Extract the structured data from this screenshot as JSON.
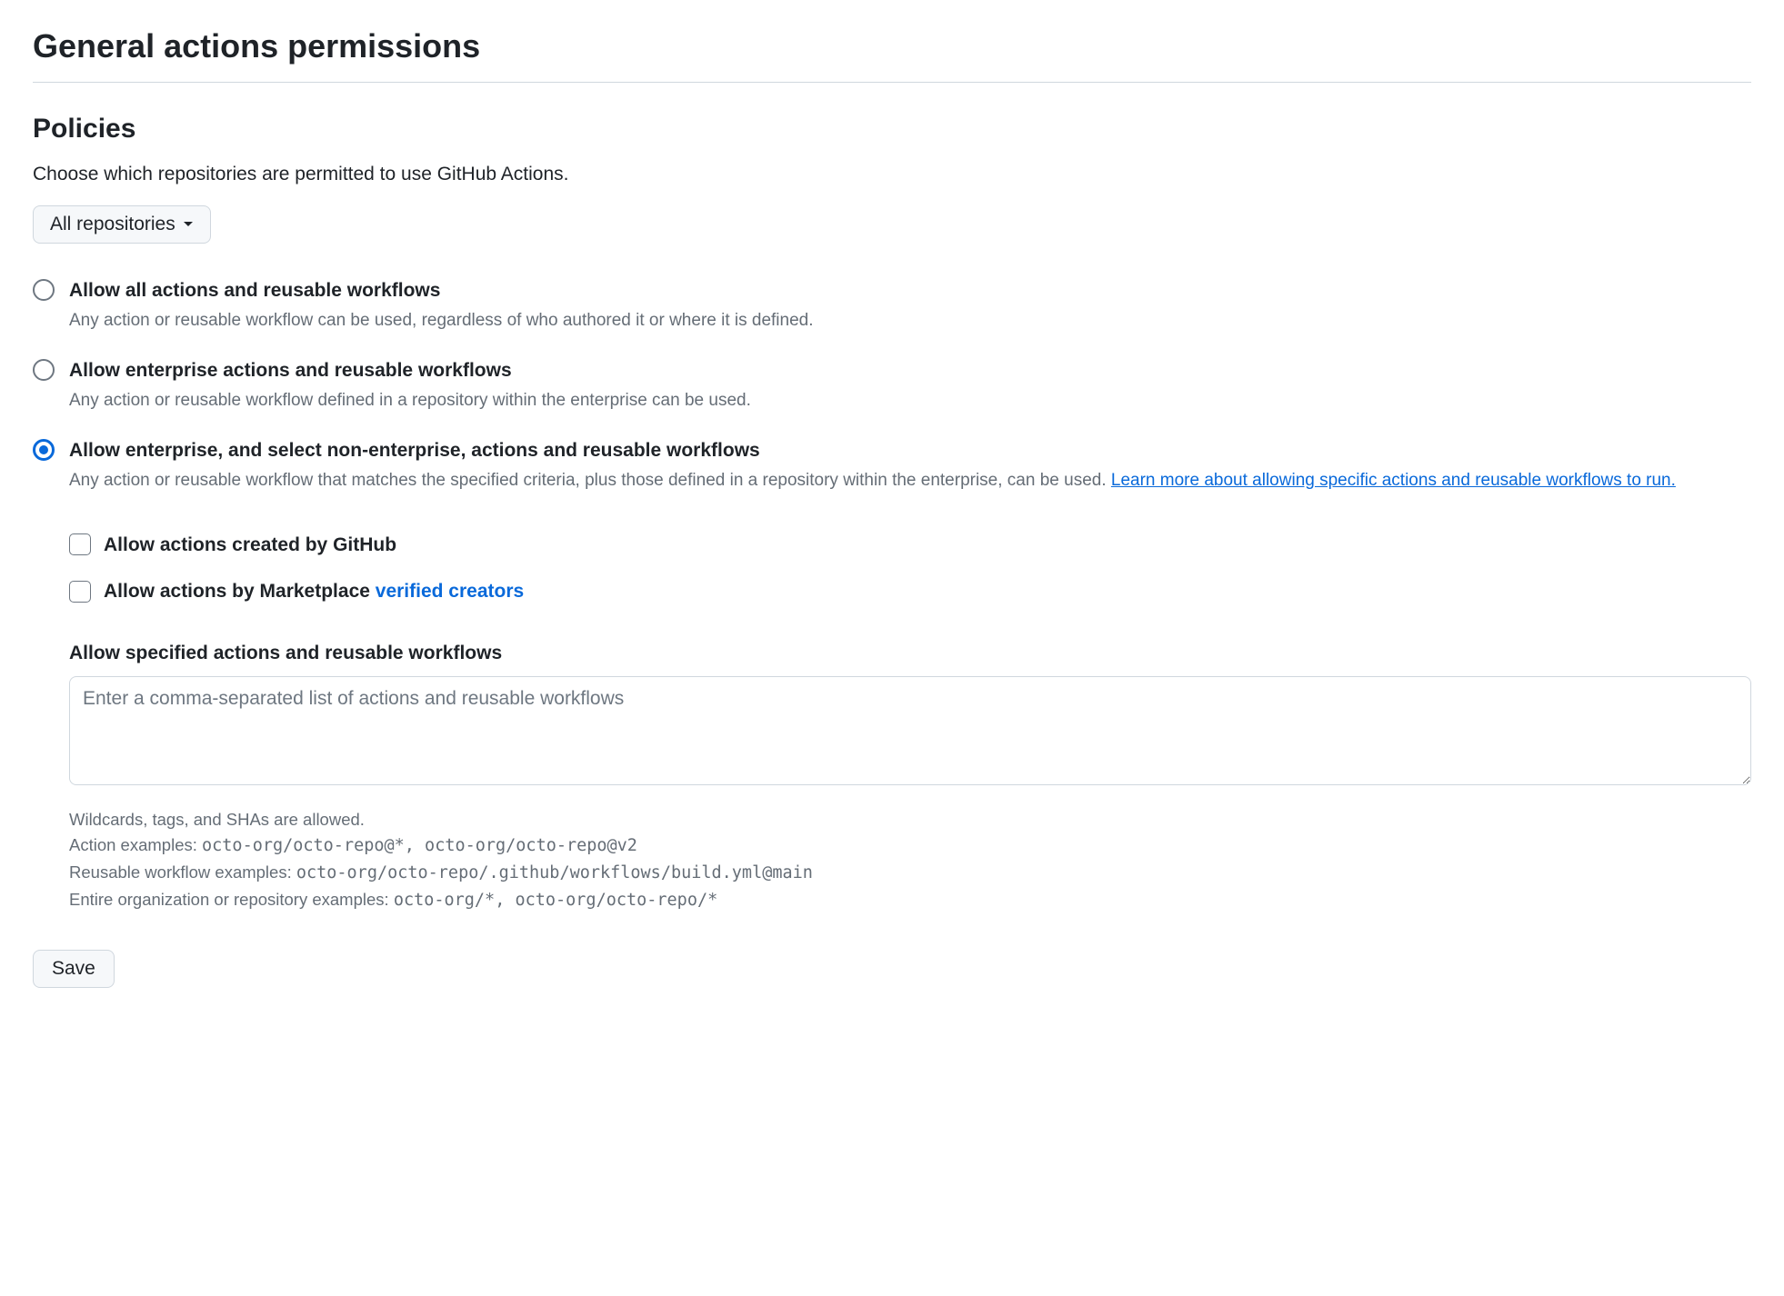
{
  "page": {
    "title": "General actions permissions"
  },
  "policies": {
    "heading": "Policies",
    "description": "Choose which repositories are permitted to use GitHub Actions.",
    "repo_selector": "All repositories",
    "options": [
      {
        "label": "Allow all actions and reusable workflows",
        "description": "Any action or reusable workflow can be used, regardless of who authored it or where it is defined.",
        "selected": false
      },
      {
        "label": "Allow enterprise actions and reusable workflows",
        "description": "Any action or reusable workflow defined in a repository within the enterprise can be used.",
        "selected": false
      },
      {
        "label": "Allow enterprise, and select non-enterprise, actions and reusable workflows",
        "description_prefix": "Any action or reusable workflow that matches the specified criteria, plus those defined in a repository within the enterprise, can be used. ",
        "learn_more": "Learn more about allowing specific actions and reusable workflows to run.",
        "selected": true
      }
    ],
    "sub": {
      "github_actions": "Allow actions created by GitHub",
      "marketplace_prefix": "Allow actions by Marketplace ",
      "marketplace_link": "verified creators",
      "specified_heading": "Allow specified actions and reusable workflows",
      "textarea_placeholder": "Enter a comma-separated list of actions and reusable workflows",
      "help": {
        "line1": "Wildcards, tags, and SHAs are allowed.",
        "line2_prefix": "Action examples: ",
        "line2_code": "octo-org/octo-repo@*, octo-org/octo-repo@v2",
        "line3_prefix": "Reusable workflow examples: ",
        "line3_code": "octo-org/octo-repo/.github/workflows/build.yml@main",
        "line4_prefix": "Entire organization or repository examples: ",
        "line4_code": "octo-org/*, octo-org/octo-repo/*"
      }
    },
    "save_label": "Save"
  }
}
